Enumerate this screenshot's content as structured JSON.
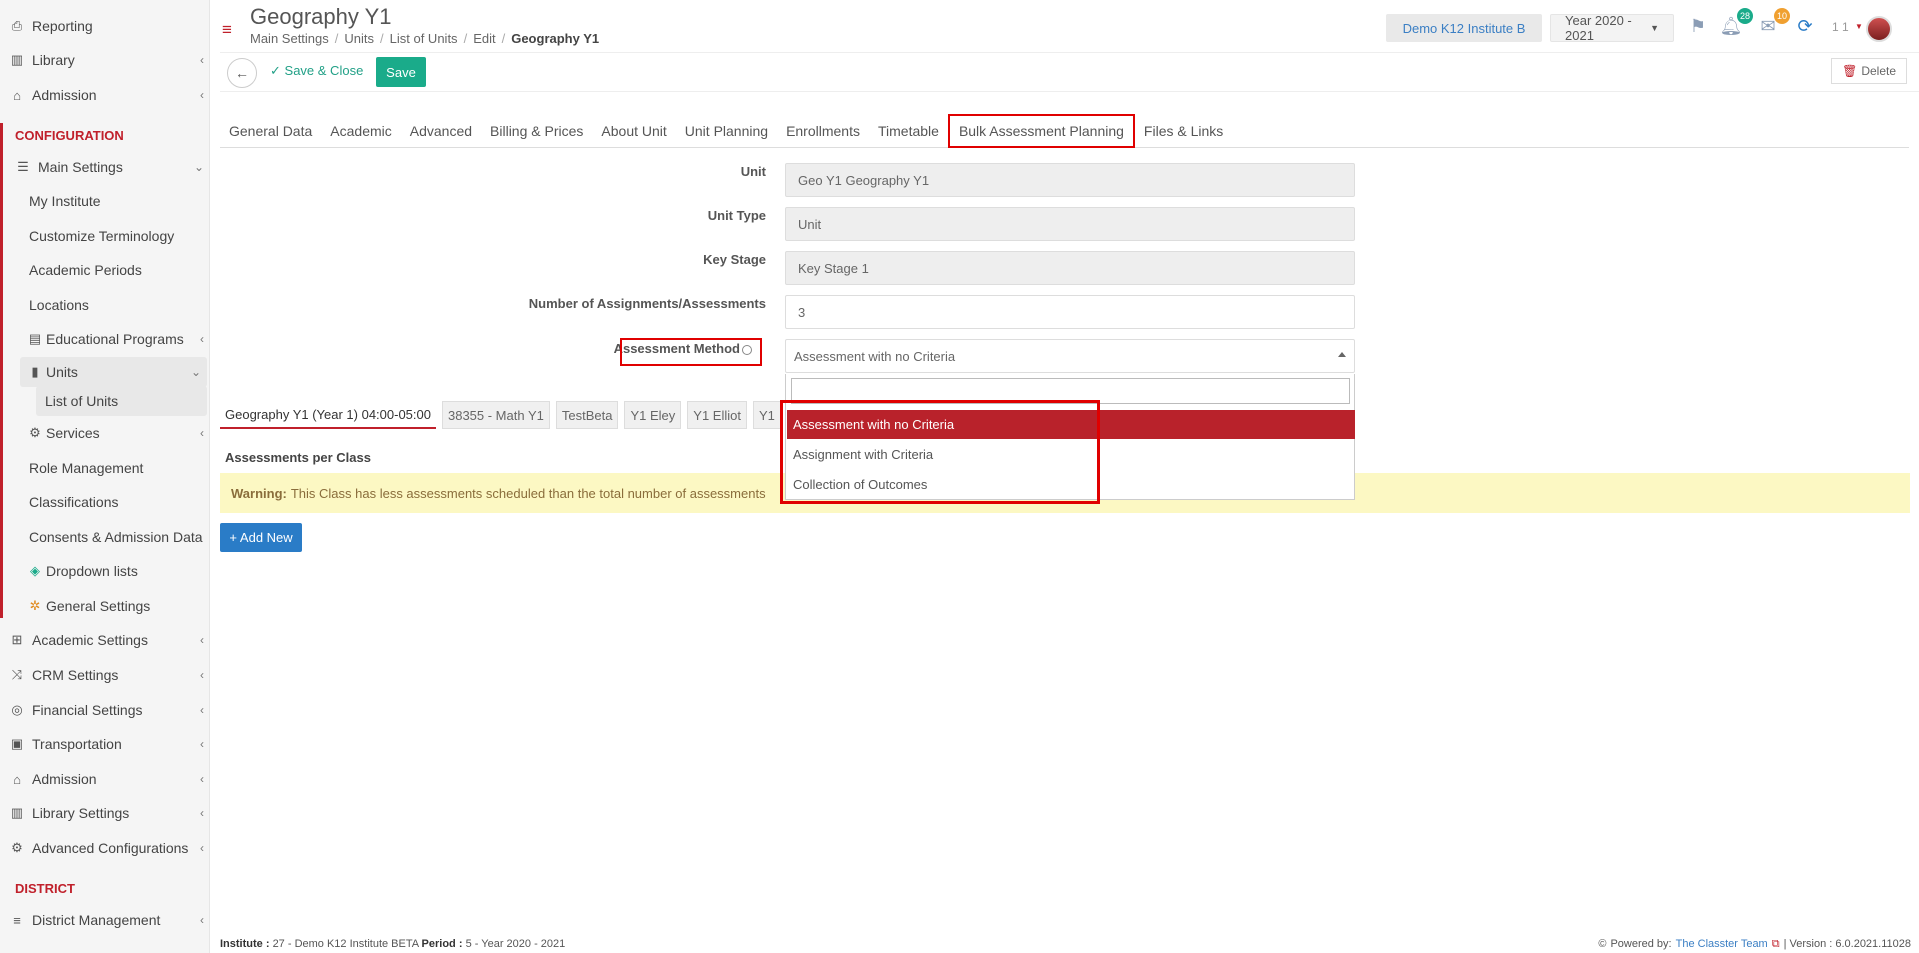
{
  "sidebar": {
    "items": [
      {
        "label": "Reporting",
        "icon": "print-icon",
        "chevron": false
      },
      {
        "label": "Library",
        "icon": "books-icon",
        "chevron": true
      },
      {
        "label": "Admission",
        "icon": "institution-icon",
        "chevron": true
      },
      {
        "label": "Main Settings",
        "icon": "sliders-icon",
        "chevron": true
      },
      {
        "label": "My Institute"
      },
      {
        "label": "Customize Terminology"
      },
      {
        "label": "Academic Periods"
      },
      {
        "label": "Locations"
      },
      {
        "label": "Educational Programs",
        "icon": "program-icon",
        "chevron": true
      },
      {
        "label": "Units",
        "icon": "book-icon",
        "chevron": true
      },
      {
        "label": "List of Units"
      },
      {
        "label": "Services",
        "icon": "services-icon",
        "chevron": true
      },
      {
        "label": "Role Management"
      },
      {
        "label": "Classifications"
      },
      {
        "label": "Consents & Admission Data"
      },
      {
        "label": "Dropdown lists",
        "icon": "layers-icon"
      },
      {
        "label": "General Settings",
        "icon": "gears-icon"
      },
      {
        "label": "Academic Settings",
        "icon": "org-chart-icon",
        "chevron": true
      },
      {
        "label": "CRM Settings",
        "icon": "shuffle-icon",
        "chevron": true
      },
      {
        "label": "Financial Settings",
        "icon": "coins-icon",
        "chevron": true
      },
      {
        "label": "Transportation",
        "icon": "bus-icon",
        "chevron": true
      },
      {
        "label": "Admission",
        "icon": "institution-icon",
        "chevron": true
      },
      {
        "label": "Library Settings",
        "icon": "books-icon",
        "chevron": true
      },
      {
        "label": "Advanced Configurations",
        "icon": "cogs-icon",
        "chevron": true
      },
      {
        "label": "District Management",
        "icon": "list-icon",
        "chevron": true
      }
    ],
    "sections": {
      "configuration": "CONFIGURATION",
      "district": "DISTRICT"
    }
  },
  "header": {
    "title": "Geography Y1",
    "breadcrumb": [
      "Main Settings",
      "Units",
      "List of Units",
      "Edit",
      "Geography Y1"
    ],
    "institute": "Demo K12 Institute B",
    "year": "Year 2020 - 2021",
    "notifications_count": "28",
    "messages_count": "10",
    "user_label": "1 1"
  },
  "toolbar": {
    "save_close_label": "Save & Close",
    "save_label": "Save",
    "delete_label": "Delete"
  },
  "tabs": [
    "General Data",
    "Academic",
    "Advanced",
    "Billing & Prices",
    "About Unit",
    "Unit Planning",
    "Enrollments",
    "Timetable",
    "Bulk Assessment Planning",
    "Files & Links"
  ],
  "form": {
    "unit_label": "Unit",
    "unit_value": "Geo Y1 Geography Y1",
    "unit_type_label": "Unit Type",
    "unit_type_value": "Unit",
    "key_stage_label": "Key Stage",
    "key_stage_value": "Key Stage 1",
    "num_assignments_label": "Number of Assignments/Assessments",
    "num_assignments_value": "3",
    "method_label": "Assessment Method",
    "method_value": "Assessment with no Criteria",
    "method_options": [
      "Assessment with no Criteria",
      "Assignment with Criteria",
      "Collection of Outcomes"
    ]
  },
  "class_tabs": [
    "Geography Y1 (Year 1) 04:00-05:00",
    "38355 - Math Y1",
    "TestBeta",
    "Y1 Eley",
    "Y1 Elliot",
    "Y1"
  ],
  "assessments": {
    "heading": "Assessments per Class",
    "warning_strong": "Warning:",
    "warning_text": "This Class has less assessments scheduled than the total number of assessments",
    "add_new_label": "Add New"
  },
  "footer": {
    "institute_key": "Institute :",
    "institute_value": "27 - Demo K12 Institute BETA",
    "period_key": "Period :",
    "period_value": "5 - Year 2020 - 2021",
    "powered_by": "Powered by:",
    "team": "The Classter Team",
    "version": "| Version : 6.0.2021.11028"
  },
  "colors": {
    "accent_red": "#c0202b",
    "save_green": "#1aab8a",
    "primary_blue": "#2a7cc7",
    "warning_bg": "#fcf8c3"
  }
}
